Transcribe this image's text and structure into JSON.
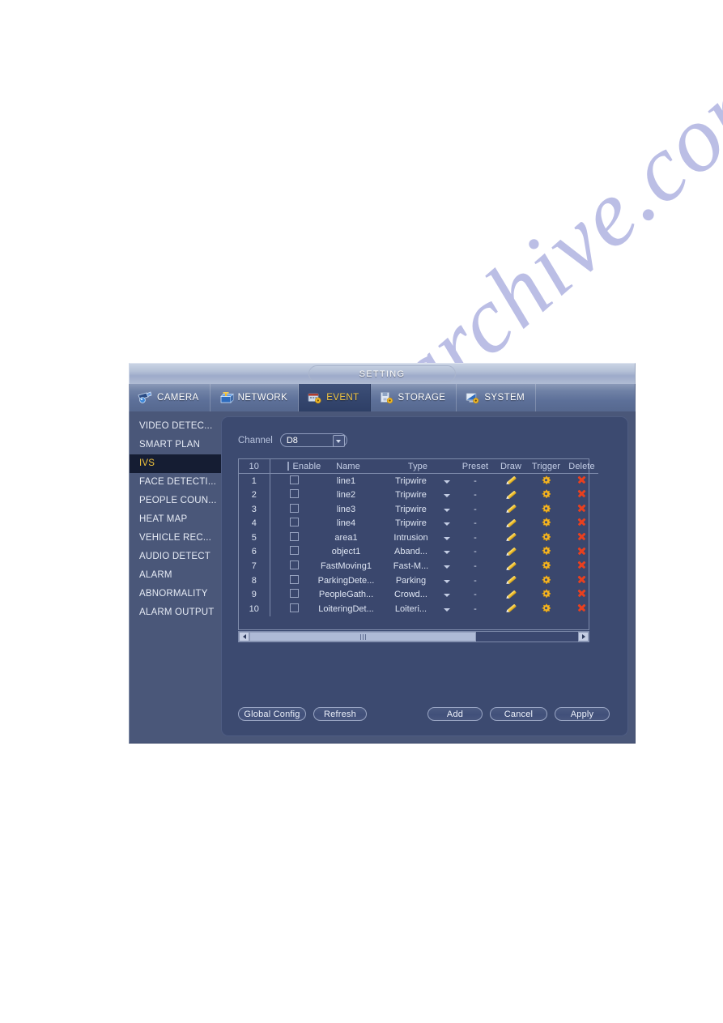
{
  "window": {
    "title": "SETTING"
  },
  "tabs": [
    {
      "label": "CAMERA",
      "icon": "camera-icon",
      "active": false
    },
    {
      "label": "NETWORK",
      "icon": "network-icon",
      "active": false
    },
    {
      "label": "EVENT",
      "icon": "event-icon",
      "active": true
    },
    {
      "label": "STORAGE",
      "icon": "storage-icon",
      "active": false
    },
    {
      "label": "SYSTEM",
      "icon": "system-icon",
      "active": false
    }
  ],
  "sidebar": {
    "items": [
      {
        "label": "VIDEO DETEC...",
        "selected": false
      },
      {
        "label": "SMART PLAN",
        "selected": false
      },
      {
        "label": "IVS",
        "selected": true
      },
      {
        "label": "FACE DETECTI...",
        "selected": false
      },
      {
        "label": "PEOPLE COUN...",
        "selected": false
      },
      {
        "label": "HEAT MAP",
        "selected": false
      },
      {
        "label": "VEHICLE REC...",
        "selected": false
      },
      {
        "label": "AUDIO DETECT",
        "selected": false
      },
      {
        "label": "ALARM",
        "selected": false
      },
      {
        "label": "ABNORMALITY",
        "selected": false
      },
      {
        "label": "ALARM OUTPUT",
        "selected": false
      }
    ]
  },
  "form": {
    "channel_label": "Channel",
    "channel_value": "D8"
  },
  "table": {
    "headers": {
      "index": "10",
      "enable": "Enable",
      "name": "Name",
      "type": "Type",
      "preset": "Preset",
      "draw": "Draw",
      "trigger": "Trigger",
      "delete": "Delete"
    },
    "rows": [
      {
        "index": "1",
        "enabled": false,
        "name": "line1",
        "type": "Tripwire",
        "preset": "-"
      },
      {
        "index": "2",
        "enabled": false,
        "name": "line2",
        "type": "Tripwire",
        "preset": "-"
      },
      {
        "index": "3",
        "enabled": false,
        "name": "line3",
        "type": "Tripwire",
        "preset": "-"
      },
      {
        "index": "4",
        "enabled": false,
        "name": "line4",
        "type": "Tripwire",
        "preset": "-"
      },
      {
        "index": "5",
        "enabled": false,
        "name": "area1",
        "type": "Intrusion",
        "preset": "-"
      },
      {
        "index": "6",
        "enabled": false,
        "name": "object1",
        "type": "Aband...",
        "preset": "-"
      },
      {
        "index": "7",
        "enabled": false,
        "name": "FastMoving1",
        "type": "Fast-M...",
        "preset": "-"
      },
      {
        "index": "8",
        "enabled": false,
        "name": "ParkingDete...",
        "type": "Parking",
        "preset": "-"
      },
      {
        "index": "9",
        "enabled": false,
        "name": "PeopleGath...",
        "type": "Crowd...",
        "preset": "-"
      },
      {
        "index": "10",
        "enabled": false,
        "name": "LoiteringDet...",
        "type": "Loiteri...",
        "preset": "-"
      }
    ]
  },
  "buttons": {
    "global_config": "Global Config",
    "refresh": "Refresh",
    "add": "Add",
    "cancel": "Cancel",
    "apply": "Apply"
  },
  "watermark": {
    "text": "manualsarchive.com"
  },
  "colors": {
    "accent_yellow": "#f0c33c",
    "delete_red": "#e8401f",
    "panel_bg": "#3c4a70",
    "window_bg": "#4a5779",
    "selected_bg": "#151d33"
  }
}
